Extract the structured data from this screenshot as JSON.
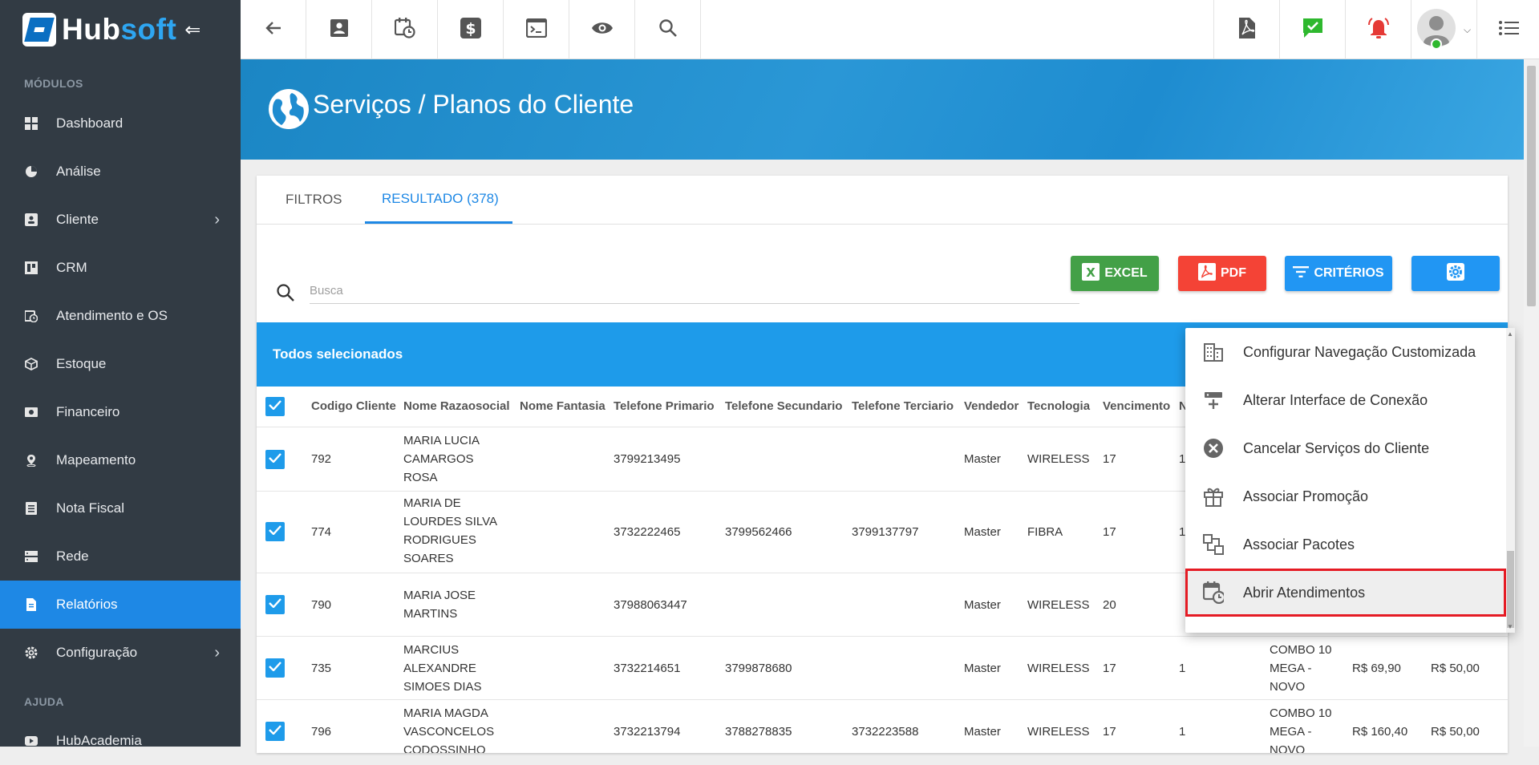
{
  "app": {
    "logo_hub": "Hub",
    "logo_soft": "soft",
    "collapse_icon": "menu-collapse-icon"
  },
  "sidebar": {
    "section_modules": "MÓDULOS",
    "section_help": "AJUDA",
    "items": [
      {
        "label": "Dashboard",
        "icon": "dashboard-icon"
      },
      {
        "label": "Análise",
        "icon": "pie-chart-icon"
      },
      {
        "label": "Cliente",
        "icon": "contact-card-icon",
        "has_children": true
      },
      {
        "label": "CRM",
        "icon": "kanban-icon"
      },
      {
        "label": "Atendimento e OS",
        "icon": "calendar-clock-icon"
      },
      {
        "label": "Estoque",
        "icon": "box-icon"
      },
      {
        "label": "Financeiro",
        "icon": "money-icon"
      },
      {
        "label": "Mapeamento",
        "icon": "map-pin-icon"
      },
      {
        "label": "Nota Fiscal",
        "icon": "receipt-icon"
      },
      {
        "label": "Rede",
        "icon": "server-icon"
      },
      {
        "label": "Relatórios",
        "icon": "document-icon",
        "active": true
      },
      {
        "label": "Configuração",
        "icon": "gear-icon",
        "has_children": true
      }
    ],
    "help_items": [
      {
        "label": "HubAcademia",
        "icon": "youtube-icon"
      }
    ]
  },
  "topbar": {
    "left_icons": [
      "back-arrow-icon",
      "contact-card-icon",
      "calendar-clock-icon",
      "dollar-icon",
      "terminal-icon",
      "eye-icon",
      "search-icon"
    ],
    "right_icons": [
      "pdf-file-icon",
      "check-message-icon",
      "alarm-bell-icon",
      "user-avatar",
      "list-menu-icon"
    ],
    "colors": {
      "check": "#2eb82e",
      "alarm": "#e53935"
    }
  },
  "banner": {
    "title": "Serviços / Planos do Cliente",
    "colors": {
      "start": "#1b86c4",
      "end": "#3aa6e2"
    }
  },
  "tabs": [
    {
      "label": "FILTROS",
      "active": false
    },
    {
      "label": "RESULTADO (378)",
      "active": true
    }
  ],
  "search": {
    "placeholder": "Busca",
    "value": ""
  },
  "actions": {
    "excel": {
      "label": "EXCEL",
      "color": "#43a047"
    },
    "pdf": {
      "label": "PDF",
      "color": "#f44336"
    },
    "criterios": {
      "label": "CRITÉRIOS",
      "color": "#2196f3"
    },
    "settings": {
      "color": "#2196f3"
    }
  },
  "table": {
    "selection_label": "Todos selecionados",
    "headers": [
      "Codigo Cliente",
      "Nome Razaosocial",
      "Nome Fantasia",
      "Telefone Primario",
      "Telefone Secundario",
      "Telefone Terciario",
      "Vendedor",
      "Tecnologia",
      "Vencimento",
      "N"
    ],
    "rows": [
      {
        "codigo": "792",
        "nome_lines": [
          "MARIA LUCIA",
          "CAMARGOS",
          "ROSA"
        ],
        "fantasia": "",
        "tel1": "3799213495",
        "tel2": "",
        "tel3": "",
        "vendedor": "Master",
        "tecnologia": "WIRELESS",
        "vencimento": "17",
        "n": "1",
        "plano_lines": [],
        "valor1": "",
        "valor2": ""
      },
      {
        "codigo": "774",
        "nome_lines": [
          "MARIA DE",
          "LOURDES SILVA",
          "RODRIGUES",
          "SOARES"
        ],
        "fantasia": "",
        "tel1": "3732222465",
        "tel2": "3799562466",
        "tel3": "3799137797",
        "vendedor": "Master",
        "tecnologia": "FIBRA",
        "vencimento": "17",
        "n": "1",
        "plano_lines": [],
        "valor1": "",
        "valor2": ""
      },
      {
        "codigo": "790",
        "nome_lines": [
          "MARIA JOSE",
          "MARTINS"
        ],
        "fantasia": "",
        "tel1": "37988063447",
        "tel2": "",
        "tel3": "",
        "vendedor": "Master",
        "tecnologia": "WIRELESS",
        "vencimento": "20",
        "n": "",
        "plano_lines": [],
        "valor1": "",
        "valor2": ""
      },
      {
        "codigo": "735",
        "nome_lines": [
          "MARCIUS",
          "ALEXANDRE",
          "SIMOES DIAS"
        ],
        "fantasia": "",
        "tel1": "3732214651",
        "tel2": "3799878680",
        "tel3": "",
        "vendedor": "Master",
        "tecnologia": "WIRELESS",
        "vencimento": "17",
        "n": "1",
        "plano_lines": [
          "COMBO 10",
          "MEGA -",
          "NOVO"
        ],
        "valor1": "R$ 69,90",
        "valor2": "R$ 50,00"
      },
      {
        "codigo": "796",
        "nome_lines": [
          "MARIA MAGDA",
          "VASCONCELOS",
          "CODOSSINHO"
        ],
        "fantasia": "",
        "tel1": "3732213794",
        "tel2": "3788278835",
        "tel3": "3732223588",
        "vendedor": "Master",
        "tecnologia": "WIRELESS",
        "vencimento": "17",
        "n": "1",
        "plano_lines": [
          "COMBO 10",
          "MEGA -",
          "NOVO"
        ],
        "valor1": "R$ 160,40",
        "valor2": "R$ 50,00"
      }
    ]
  },
  "menu": {
    "items": [
      {
        "label": "Configurar Navegação Customizada",
        "icon": "building-icon"
      },
      {
        "label": "Alterar Interface de Conexão",
        "icon": "network-add-icon"
      },
      {
        "label": "Cancelar Serviços do Cliente",
        "icon": "cancel-circle-icon"
      },
      {
        "label": "Associar Promoção",
        "icon": "gift-icon"
      },
      {
        "label": "Associar Pacotes",
        "icon": "package-link-icon"
      },
      {
        "label": "Abrir Atendimentos",
        "icon": "calendar-clock-icon",
        "highlighted": true
      }
    ],
    "highlight_color": "#e51b24"
  }
}
